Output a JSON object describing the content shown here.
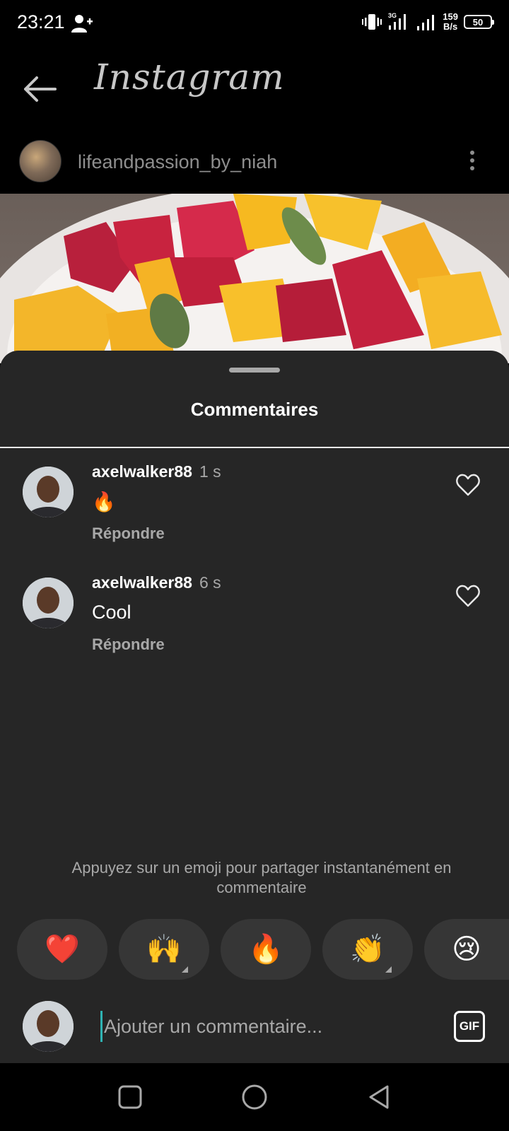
{
  "status_bar": {
    "time": "23:21",
    "net_speed_value": "159",
    "net_speed_unit": "B/s",
    "battery": "50",
    "signal_label": "3G"
  },
  "header": {
    "title": "Instagram",
    "back_icon": "arrow-left-icon"
  },
  "post": {
    "username": "lifeandpassion_by_niah",
    "more_icon": "more-vertical-icon"
  },
  "comments_sheet": {
    "title": "Commentaires",
    "comments": [
      {
        "username": "axelwalker88",
        "time": "1 s",
        "text": "🔥",
        "reply_label": "Répondre"
      },
      {
        "username": "axelwalker88",
        "time": "6 s",
        "text": "Cool",
        "reply_label": "Répondre"
      }
    ],
    "emoji_hint": "Appuyez sur un emoji pour partager instantanément en commentaire",
    "emojis": [
      "❤️",
      "🙌",
      "🔥",
      "👏",
      "😢"
    ],
    "composer": {
      "placeholder": "Ajouter un commentaire...",
      "gif_label": "GIF"
    }
  },
  "nav": [
    "square-icon",
    "circle-icon",
    "triangle-back-icon"
  ],
  "colors": {
    "background": "#000000",
    "sheet": "#262626",
    "muted_text": "#a8a8a8",
    "cursor": "#2fb3b3"
  }
}
